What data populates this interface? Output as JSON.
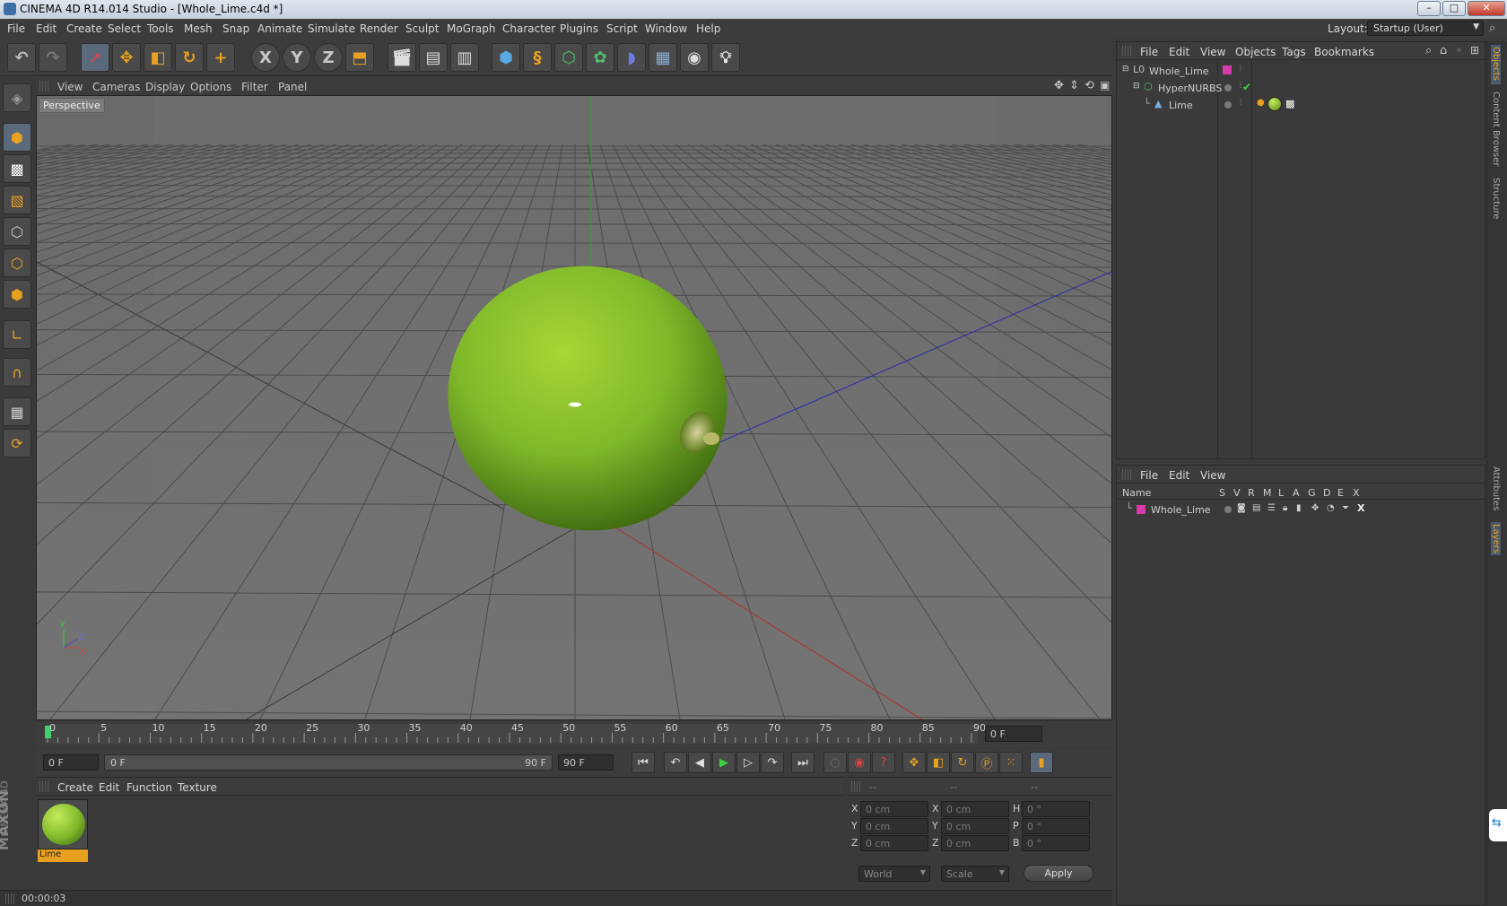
{
  "window": {
    "title": "CINEMA 4D R14.014 Studio - [Whole_Lime.c4d *]",
    "min_label": "–",
    "max_label": "□",
    "close_label": "✕"
  },
  "menubar": {
    "items": [
      "File",
      "Edit",
      "Create",
      "Select",
      "Tools",
      "Mesh",
      "Snap",
      "Animate",
      "Simulate",
      "Render",
      "Sculpt",
      "MoGraph",
      "Character",
      "Plugins",
      "Script",
      "Window",
      "Help"
    ],
    "layout_label": "Layout:",
    "layout_value": "Startup (User)"
  },
  "toolbar": {
    "axis_x": "X",
    "axis_y": "Y",
    "axis_z": "Z"
  },
  "viewport": {
    "menus": [
      "View",
      "Cameras",
      "Display",
      "Options",
      "Filter",
      "Panel"
    ],
    "camera_label": "Perspective",
    "axis_y": "Y",
    "axis_z": "Z",
    "axis_x": "X"
  },
  "timeline": {
    "ticks": [
      "0",
      "5",
      "10",
      "15",
      "20",
      "25",
      "30",
      "35",
      "40",
      "45",
      "50",
      "55",
      "60",
      "65",
      "70",
      "75",
      "80",
      "85",
      "90"
    ],
    "current_frame": "0 F",
    "start_field": "0 F",
    "range_start": "0 F",
    "range_end": "90 F",
    "end_field": "90 F"
  },
  "material_manager": {
    "menus": [
      "Create",
      "Edit",
      "Function",
      "Texture"
    ],
    "materials": [
      {
        "name": "Lime"
      }
    ]
  },
  "coordinates": {
    "headers": [
      "--",
      "--",
      "--"
    ],
    "rows": [
      {
        "a": "X",
        "a_val": "0 cm",
        "b": "X",
        "b_val": "0 cm",
        "c": "H",
        "c_val": "0 °"
      },
      {
        "a": "Y",
        "a_val": "0 cm",
        "b": "Y",
        "b_val": "0 cm",
        "c": "P",
        "c_val": "0 °"
      },
      {
        "a": "Z",
        "a_val": "0 cm",
        "b": "Z",
        "b_val": "0 cm",
        "c": "B",
        "c_val": "0 °"
      }
    ],
    "mode_select": "World",
    "size_select": "Scale",
    "apply_label": "Apply"
  },
  "status": {
    "time": "00:00:03"
  },
  "object_manager": {
    "menus": [
      "File",
      "Edit",
      "View",
      "Objects",
      "Tags",
      "Bookmarks"
    ],
    "objects": [
      {
        "name": "Whole_Lime"
      },
      {
        "name": "HyperNURBS"
      },
      {
        "name": "Lime"
      }
    ]
  },
  "layer_manager": {
    "menus": [
      "File",
      "Edit",
      "View"
    ],
    "columns": [
      "Name",
      "S",
      "V",
      "R",
      "M",
      "L",
      "A",
      "G",
      "D",
      "E",
      "X"
    ],
    "layers": [
      {
        "name": "Whole_Lime",
        "color": "#d63ca8"
      }
    ]
  },
  "side_tabs": {
    "objects": "Objects",
    "content_browser": "Content Browser",
    "structure": "Structure",
    "attributes": "Attributes",
    "layers": "Layers"
  },
  "branding": {
    "maxon": "MAXON",
    "cinema": "CINEMA 4D"
  },
  "colors": {
    "accent": "#e8a020",
    "layer_color": "#d63ca8",
    "lime": "#7fb82a"
  }
}
